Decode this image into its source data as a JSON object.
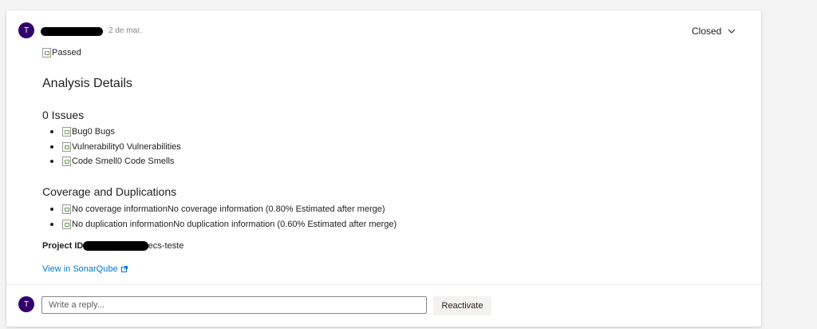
{
  "thread": {
    "author_initial": "T",
    "timestamp": "2 de mar.",
    "status": "Closed"
  },
  "comment": {
    "passed_alt": "Passed",
    "title": "Analysis Details",
    "issues_heading": "0 Issues",
    "issues": [
      {
        "alt": "Bug",
        "text": "0 Bugs"
      },
      {
        "alt": "Vulnerability",
        "text": "0 Vulnerabilities"
      },
      {
        "alt": "Code Smell",
        "text": "0 Code Smells"
      }
    ],
    "coverage_heading": "Coverage and Duplications",
    "coverage": [
      {
        "alt": "No coverage information",
        "text": "No coverage information (0.80% Estimated after merge)"
      },
      {
        "alt": "No duplication information",
        "text": "No duplication information (0.60% Estimated after merge)"
      }
    ],
    "project_label": "Project ID:",
    "project_suffix": "-ecs-teste",
    "sonar_link": "View in SonarQube"
  },
  "reply": {
    "author_initial": "T",
    "placeholder": "Write a reply...",
    "reactivate_label": "Reactivate"
  },
  "colors": {
    "avatar": "#33006b",
    "link": "#0078d4"
  }
}
